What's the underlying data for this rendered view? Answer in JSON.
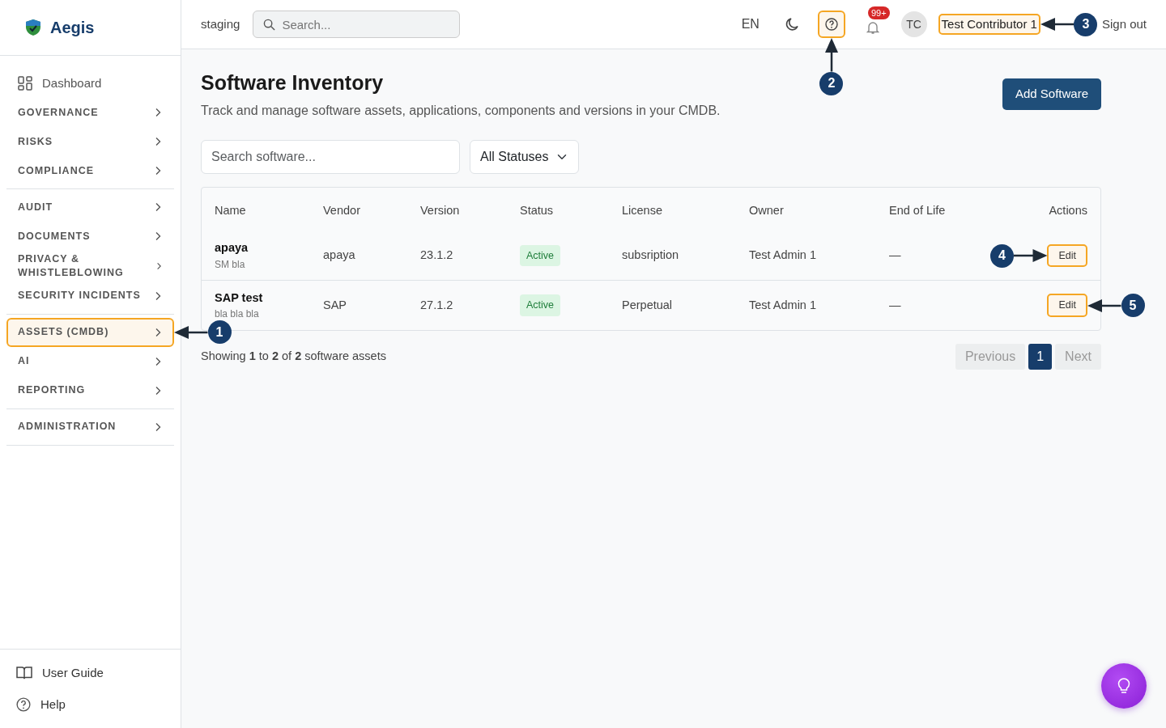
{
  "brand": {
    "name": "Aegis"
  },
  "sidebar": {
    "groups": [
      {
        "items": [
          {
            "kind": "link",
            "label": "Dashboard",
            "highlighted": false
          },
          {
            "kind": "section",
            "label": "GOVERNANCE",
            "highlighted": false
          },
          {
            "kind": "section",
            "label": "RISKS",
            "highlighted": false
          },
          {
            "kind": "section",
            "label": "COMPLIANCE",
            "highlighted": false
          }
        ]
      },
      {
        "items": [
          {
            "kind": "section",
            "label": "AUDIT",
            "highlighted": false
          },
          {
            "kind": "section",
            "label": "DOCUMENTS",
            "highlighted": false
          },
          {
            "kind": "section",
            "label": "PRIVACY & WHISTLEBLOWING",
            "highlighted": false
          },
          {
            "kind": "section",
            "label": "SECURITY INCIDENTS",
            "highlighted": false
          }
        ]
      },
      {
        "items": [
          {
            "kind": "section",
            "label": "ASSETS (CMDB)",
            "highlighted": true,
            "callout": "1"
          },
          {
            "kind": "section",
            "label": "AI",
            "highlighted": false
          },
          {
            "kind": "section",
            "label": "REPORTING",
            "highlighted": false
          }
        ]
      },
      {
        "items": [
          {
            "kind": "section",
            "label": "ADMINISTRATION",
            "highlighted": false
          }
        ]
      }
    ],
    "footer": [
      {
        "kind": "guide",
        "label": "User Guide"
      },
      {
        "kind": "help",
        "label": "Help"
      }
    ]
  },
  "topbar": {
    "environment": "staging",
    "search": {
      "placeholder": "Search..."
    },
    "language": "EN",
    "help": {
      "highlighted": true,
      "callout": "2",
      "callout_below": true
    },
    "notifications": {
      "badge": "99+"
    },
    "avatar": "TC",
    "user": {
      "name": "Test Contributor 1",
      "highlighted": true,
      "callout": "3"
    },
    "sign_out": "Sign out"
  },
  "page": {
    "title": "Software Inventory",
    "subtitle": "Track and manage software assets, applications, components and versions in your CMDB.",
    "add_button": "Add Software"
  },
  "filters": {
    "search": {
      "placeholder": "Search software..."
    },
    "status": "All Statuses"
  },
  "table": {
    "columns": [
      "Name",
      "Vendor",
      "Version",
      "Status",
      "License",
      "Owner",
      "End of Life",
      "Actions"
    ],
    "rows": [
      {
        "name": "apaya",
        "description": "SM bla",
        "vendor": "apaya",
        "version": "23.1.2",
        "status": "Active",
        "license": "subsription",
        "owner": "Test Admin 1",
        "end_of_life": "—",
        "action": "Edit",
        "highlighted": true,
        "callout": "4",
        "callout_left": true
      },
      {
        "name": "SAP test",
        "description": "bla bla bla",
        "vendor": "SAP",
        "version": "27.1.2",
        "status": "Active",
        "license": "Perpetual",
        "owner": "Test Admin 1",
        "end_of_life": "—",
        "action": "Edit",
        "highlighted": true,
        "callout": "5"
      }
    ]
  },
  "summary": "Showing **1** to **2** of **2** software assets",
  "pagination": [
    {
      "label": "Previous",
      "kind": "nav",
      "disabled": true,
      "selected": false
    },
    {
      "label": "1",
      "kind": "page",
      "disabled": false,
      "selected": true
    },
    {
      "label": "Next",
      "kind": "nav",
      "disabled": true,
      "selected": false
    }
  ]
}
